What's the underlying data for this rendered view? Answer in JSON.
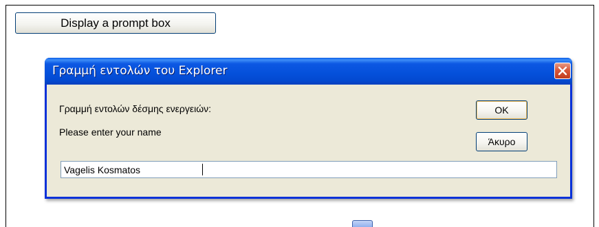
{
  "page": {
    "prompt_button_label": "Display a prompt box"
  },
  "dialog": {
    "title": "Γραμμή εντολών του Explorer",
    "caption": "Γραμμή εντολών δέσμης ενεργειών:",
    "message": "Please enter your name",
    "ok_label": "OK",
    "cancel_label": "Άκυρο",
    "input_value": "Vagelis Kosmatos",
    "close_icon": "close-icon"
  },
  "colors": {
    "titlebar": "#0450da",
    "dialog_bg": "#ece9d8",
    "border": "#0831d9",
    "close_button": "#d8573a"
  }
}
